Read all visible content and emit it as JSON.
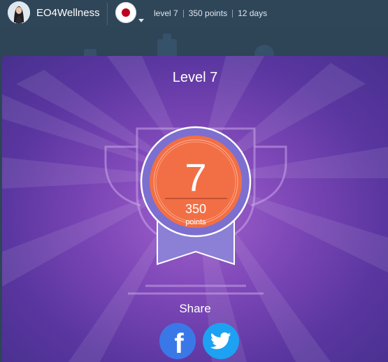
{
  "header": {
    "username": "EO4Wellness",
    "level": "level 7",
    "points": "350 points",
    "days": "12 days",
    "flag_icon": "japan-flag-icon"
  },
  "modal": {
    "title": "Level 7",
    "badge_level": "7",
    "badge_points": "350",
    "badge_points_unit": "points",
    "share_label": "Share",
    "share_buttons": [
      "facebook-icon",
      "twitter-icon"
    ]
  },
  "colors": {
    "topbar": "#2f4659",
    "modal_bg": "#7f48b8",
    "badge_orange": "#f26f45",
    "badge_ring": "#7c6fd0",
    "facebook": "#3b78e7",
    "twitter": "#1da1f2"
  }
}
